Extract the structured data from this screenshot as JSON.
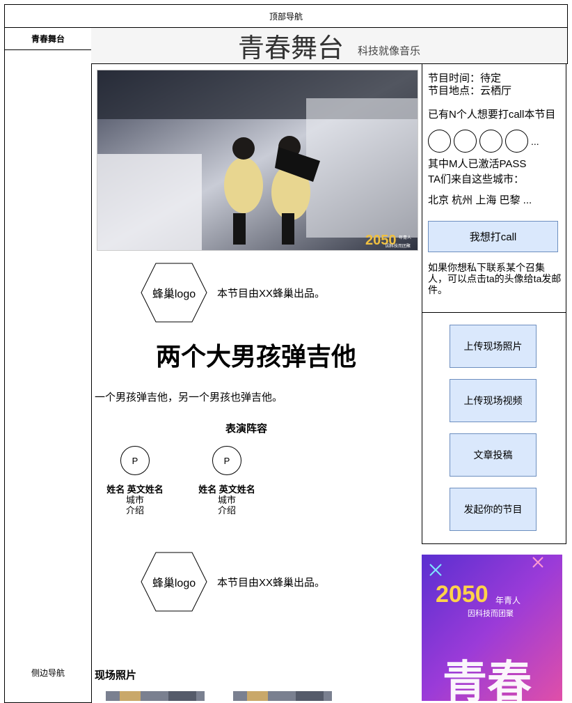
{
  "top_nav": "顶部导航",
  "sidebar": {
    "title": "青春舞台",
    "nav_label": "侧边导航"
  },
  "header": {
    "title": "青春舞台",
    "subtitle": "科技就像音乐"
  },
  "hero_image": {
    "overlay_text": "2050",
    "sub_text_1": "年青人",
    "sub_text_2": "因科技而团聚"
  },
  "producer": {
    "logo_label": "蜂巢logo",
    "text": "本节目由XX蜂巢出品。"
  },
  "program": {
    "title": "两个大男孩弹吉他",
    "description": "一个男孩弹吉他，另一个男孩也弹吉他。"
  },
  "lineup": {
    "title": "表演阵容",
    "performers": [
      {
        "avatar": "P",
        "name": "姓名 英文姓名",
        "city": "城市",
        "intro": "介绍"
      },
      {
        "avatar": "P",
        "name": "姓名 英文姓名",
        "city": "城市",
        "intro": "介绍"
      }
    ]
  },
  "photos": {
    "title": "现场照片"
  },
  "info": {
    "time": "节目时间：待定",
    "place": "节目地点：云栖厅",
    "call_count": "已有N个人想要打call本节目",
    "more": "...",
    "pass_count": "其中M人已激活PASS",
    "cities_label": "TA们来自这些城市：",
    "cities": "北京 杭州 上海 巴黎 ...",
    "call_button": "我想打call",
    "note": "如果你想私下联系某个召集人，可以点击ta的头像给ta发邮件。"
  },
  "actions": [
    "上传现场照片",
    "上传现场视频",
    "文章投稿",
    "发起你的节目"
  ],
  "poster": {
    "big_text": "2050",
    "line1": "年青人",
    "line2": "因科技而团聚",
    "brand": "青春"
  },
  "colors": {
    "button_fill": "#dae8fc",
    "button_border": "#6c8ebf"
  }
}
